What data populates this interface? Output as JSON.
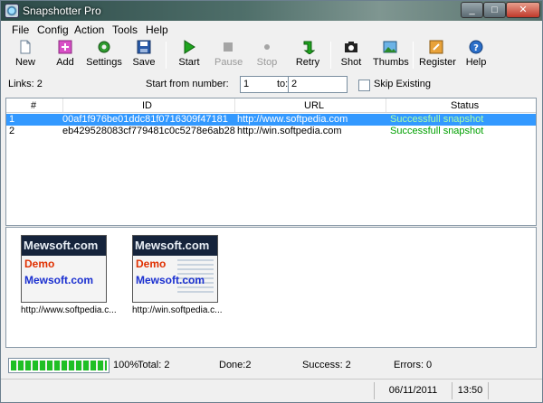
{
  "window": {
    "title": "Snapshotter Pro"
  },
  "menu": [
    "File",
    "Config",
    "Action",
    "Tools",
    "Help"
  ],
  "toolbar": {
    "new": "New",
    "add": "Add",
    "settings": "Settings",
    "save": "Save",
    "start": "Start",
    "pause": "Pause",
    "stop": "Stop",
    "retry": "Retry",
    "shot": "Shot",
    "thumbs": "Thumbs",
    "register": "Register",
    "help": "Help"
  },
  "options": {
    "links_label": "Links: 2",
    "start_from_label": "Start from number:",
    "start_from_value": "1",
    "to_label": "to:",
    "to_value": "2",
    "skip_existing_label": "Skip Existing",
    "skip_existing_checked": false
  },
  "table": {
    "headers": {
      "num": "#",
      "id": "ID",
      "url": "URL",
      "status": "Status"
    },
    "rows": [
      {
        "num": "1",
        "id": "00af1f976be01ddc81f0716309f47181",
        "url": "http://www.softpedia.com",
        "status": "Successfull snapshot",
        "selected": true
      },
      {
        "num": "2",
        "id": "eb429528083cf779481c0c5278e6ab28",
        "url": "http://win.softpedia.com",
        "status": "Successfull snapshot",
        "selected": false
      }
    ]
  },
  "thumbnails": [
    {
      "caption": "http://www.softpedia.c...",
      "brand_top": "Mewsoft.com",
      "demo": "Demo",
      "brand_bottom": "Mewsoft.com"
    },
    {
      "caption": "http://win.softpedia.c...",
      "brand_top": "Mewsoft.com",
      "demo": "Demo",
      "brand_bottom": "Mewsoft.com"
    }
  ],
  "progress": {
    "percent_value": 100,
    "percent_label": "100%",
    "total": "Total: 2",
    "done": "Done:2",
    "success": "Success: 2",
    "errors": "Errors: 0"
  },
  "statusbar": {
    "date": "06/11/2011",
    "time": "13:50"
  },
  "colors": {
    "selection": "#3399ff",
    "status_ok": "#00a000",
    "progress": "#1fbf25"
  }
}
